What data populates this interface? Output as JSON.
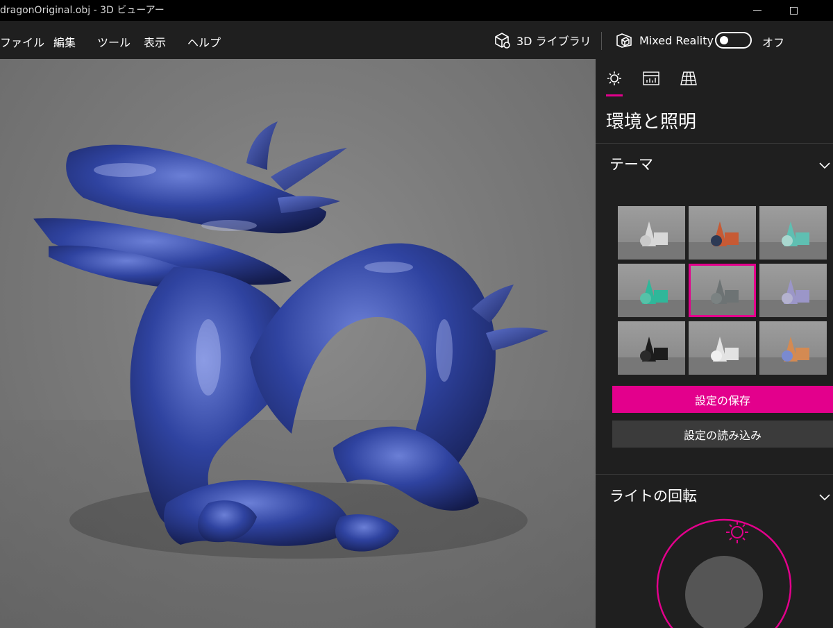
{
  "window": {
    "title": "dragonOriginal.obj - 3D ビューアー"
  },
  "menu": {
    "items": [
      "ファイル",
      "編集",
      "ツール",
      "表示",
      "ヘルプ"
    ]
  },
  "toolbar": {
    "library_label": "3D ライブラリ",
    "mixed_reality_label": "Mixed Reality",
    "toggle_state_label": "オフ",
    "toggle_on": false
  },
  "panel": {
    "title": "環境と照明",
    "tabs": [
      {
        "icon": "sun-icon",
        "active": true
      },
      {
        "icon": "stats-icon",
        "active": false
      },
      {
        "icon": "grid-icon",
        "active": false
      }
    ],
    "theme": {
      "heading": "テーマ",
      "selected_index": 4,
      "tiles": [
        {
          "primary": "#d8d8d8",
          "secondary": "#c9c9c9"
        },
        {
          "primary": "#c75a34",
          "secondary": "#2d3a55"
        },
        {
          "primary": "#5fbfb2",
          "secondary": "#a9d7cf"
        },
        {
          "primary": "#2fb79a",
          "secondary": "#56c1a8"
        },
        {
          "primary": "#6d7374",
          "secondary": "#7b8282"
        },
        {
          "primary": "#9b96c8",
          "secondary": "#b4b2cf"
        },
        {
          "primary": "#1c1c1c",
          "secondary": "#2a2a2a"
        },
        {
          "primary": "#e3e3e3",
          "secondary": "#f0f0f0"
        },
        {
          "primary": "#d48a52",
          "secondary": "#7a8ad0"
        }
      ]
    },
    "save_label": "設定の保存",
    "load_label": "設定の読み込み",
    "light_rotation": {
      "heading": "ライトの回転"
    }
  },
  "colors": {
    "accent": "#e3008c",
    "model": "#2c3f99"
  }
}
